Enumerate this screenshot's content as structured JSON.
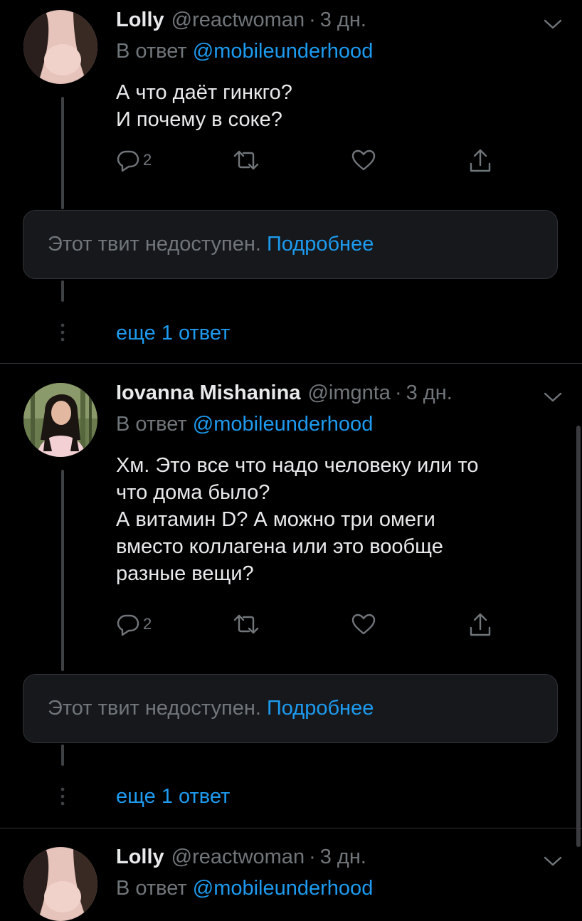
{
  "tweets": [
    {
      "name": "Lolly",
      "handle": "@reactwoman",
      "separator": "·",
      "time": "3 дн.",
      "reply_prefix": "В ответ",
      "reply_mention": "@mobileunderhood",
      "lines": [
        "А что даёт гинкго?",
        "И почему в соке?"
      ],
      "reply_count": "2",
      "unavailable_text": "Этот твит недоступен.",
      "unavailable_link": "Подробнее",
      "more_replies": "еще 1 ответ"
    },
    {
      "name": "Iovanna Mishanina",
      "handle": "@imgnta",
      "separator": "·",
      "time": "3 дн.",
      "reply_prefix": "В ответ",
      "reply_mention": "@mobileunderhood",
      "lines": [
        "Хм. Это все что надо человеку или то",
        "что дома было?",
        "А витамин D? А можно три омеги",
        "вместо коллагена или это вообще",
        "разные вещи?"
      ],
      "reply_count": "2",
      "unavailable_text": "Этот твит недоступен.",
      "unavailable_link": "Подробнее",
      "more_replies": "еще 1 ответ"
    },
    {
      "name": "Lolly",
      "handle": "@reactwoman",
      "separator": "·",
      "time": "3 дн.",
      "reply_prefix": "В ответ",
      "reply_mention": "@mobileunderhood"
    }
  ],
  "colors": {
    "background": "#000000",
    "text": "#e7e9ea",
    "muted": "#71767b",
    "accent": "#1d9bf0",
    "card": "#16181c",
    "divider": "#2f3336"
  },
  "icons": {
    "reply": "reply-icon",
    "retweet": "retweet-icon",
    "like": "heart-icon",
    "share": "share-icon",
    "menu": "chevron-down-icon",
    "more": "vertical-dots-icon"
  }
}
